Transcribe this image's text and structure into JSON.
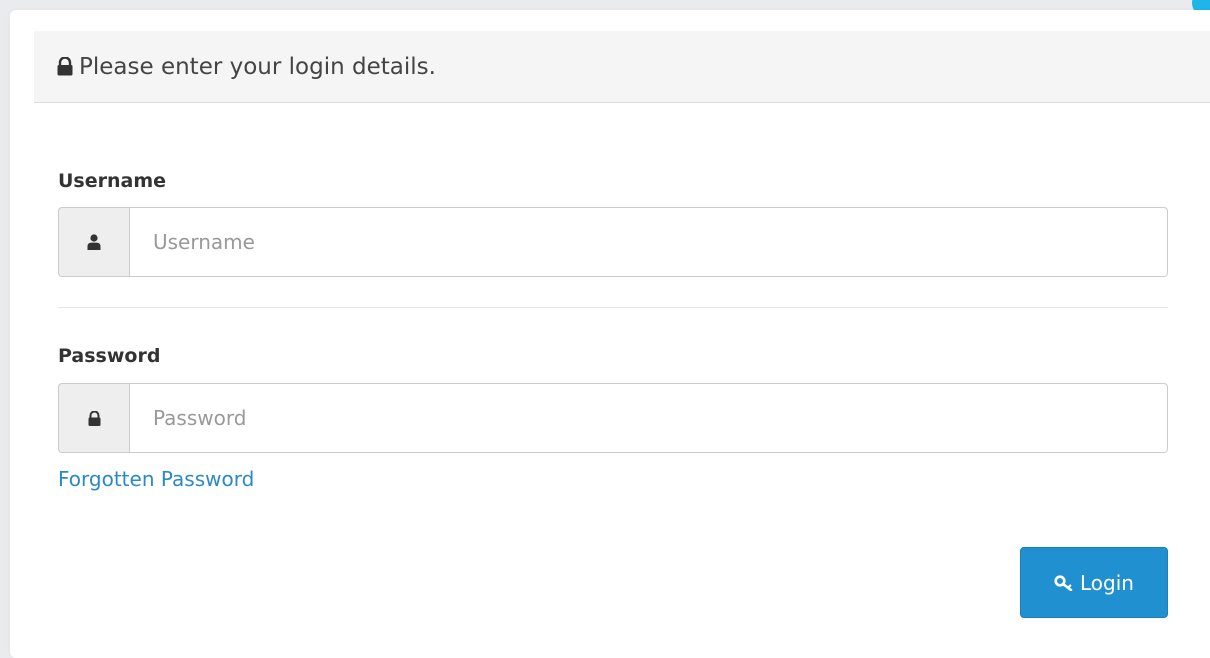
{
  "header": {
    "title": "Please enter your login details.",
    "icon": "lock-icon"
  },
  "form": {
    "username": {
      "label": "Username",
      "placeholder": "Username",
      "value": "",
      "icon": "user-icon"
    },
    "password": {
      "label": "Password",
      "placeholder": "Password",
      "value": "",
      "icon": "lock-icon"
    },
    "forgot_label": "Forgotten Password",
    "login_label": "Login",
    "login_icon": "key-icon"
  },
  "colors": {
    "accent": "#2190d0",
    "link": "#2a8ac7",
    "header_bg": "#f5f5f5",
    "addon_bg": "#eeeeee"
  }
}
